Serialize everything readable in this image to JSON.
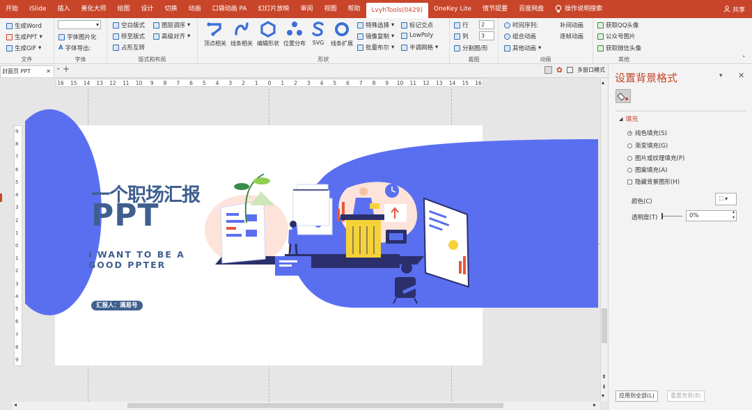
{
  "tabs": [
    "开始",
    "iSlide",
    "插入",
    "美化大师",
    "绘图",
    "设计",
    "切换",
    "动画",
    "口袋动画 PA",
    "幻灯片放映",
    "审阅",
    "视图",
    "帮助",
    "LvyhTools(0429)",
    "OneKey Lite",
    "情节提要",
    "百度网盘",
    "操作说明搜索"
  ],
  "share": "共享",
  "ribbon": {
    "file": {
      "label": "文件",
      "items": [
        "生成Word",
        "生成PPT",
        "生成GIF"
      ]
    },
    "font": {
      "label": "字体",
      "items": [
        "字体图片化",
        "字体导出:"
      ]
    },
    "layout": {
      "label": "版式和布局",
      "items": [
        "空白版式",
        "图层调序",
        "移至版式",
        "高级对齐",
        "占形互转"
      ]
    },
    "shape": {
      "label": "形状",
      "big": [
        "顶点相关",
        "线条相关",
        "编辑形状",
        "位置分布",
        "SVG",
        "线条扩展"
      ],
      "items": [
        "特殊选择",
        "标记交点",
        "镜像复制",
        "LowPoly",
        "批量布尔",
        "半调网格"
      ]
    },
    "crop": {
      "label": "裁图",
      "items": [
        "行",
        "列",
        "分割图/形"
      ],
      "values": [
        "2",
        "3"
      ]
    },
    "anim": {
      "label": "动画",
      "items": [
        "时间序列:",
        "补间动画",
        "组合动画",
        "逐帧动画",
        "其他动画"
      ]
    },
    "other": {
      "label": "其他",
      "items": [
        "获取QQ头像",
        "公众号图片",
        "获取微信头像"
      ]
    }
  },
  "doc": {
    "tab": "封面页 PPT",
    "multiwin": "多窗口模式"
  },
  "ruler": {
    "h": [
      "16",
      "15",
      "14",
      "13",
      "12",
      "11",
      "10",
      "9",
      "8",
      "7",
      "6",
      "5",
      "4",
      "3",
      "2",
      "1",
      "0",
      "1",
      "2",
      "3",
      "4",
      "5",
      "6",
      "7",
      "8",
      "9",
      "10",
      "11",
      "12",
      "13",
      "14",
      "15",
      "16"
    ],
    "v": [
      "9",
      "8",
      "7",
      "6",
      "5",
      "4",
      "3",
      "2",
      "1",
      "0",
      "1",
      "2",
      "3",
      "4",
      "5",
      "6",
      "7",
      "8",
      "9"
    ]
  },
  "slide": {
    "title": "一个职场汇报",
    "title2": "PPT",
    "sub1": "I WANT TO BE A",
    "sub2": "GOOD PPTER",
    "reporter": "汇报人：满易号",
    "colors": {
      "blue": "#5a6ff0",
      "navy": "#2b2f6b",
      "peach": "#fde3da",
      "yellow": "#f6d23a",
      "red": "#e8553b",
      "text": "#3f5f8f"
    }
  },
  "pane": {
    "title": "设置背景格式",
    "section": "填充",
    "options": [
      "纯色填充(S)",
      "渐变填充(G)",
      "图片或纹理填充(P)",
      "图案填充(A)"
    ],
    "hide": "隐藏背景图形(H)",
    "color": "颜色(C)",
    "transparency": "透明度(T)",
    "transValue": "0%",
    "apply": "应用到全部(L)",
    "reset": "重置背景(B)"
  }
}
